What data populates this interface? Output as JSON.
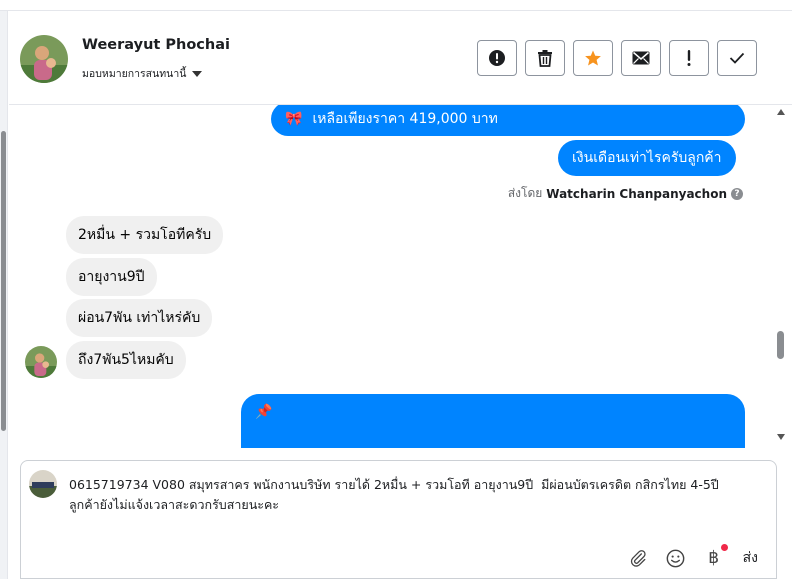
{
  "contact": {
    "name": "Weerayut Phochai",
    "assign_label": "มอบหมายการสนทนานี้"
  },
  "actions": [
    {
      "id": "spam",
      "icon": "alert-circle-icon"
    },
    {
      "id": "delete",
      "icon": "trash-icon"
    },
    {
      "id": "star",
      "icon": "star-icon",
      "color": "#f7931e"
    },
    {
      "id": "mark-unread",
      "icon": "envelope-icon"
    },
    {
      "id": "follow-up",
      "icon": "exclamation-icon"
    },
    {
      "id": "done",
      "icon": "check-icon"
    }
  ],
  "messages": {
    "out_price": {
      "emoji": "🎀",
      "text": "เหลือเพียงราคา 419,000 บาท"
    },
    "out_salary": "เงินเดือนเท่าไรครับลูกค้า",
    "sent_by_prefix": "ส่งโดย",
    "sent_by_name": "Watcharin Chanpanyachon",
    "in_1": "2หมื่น + รวมโอทีครับ",
    "in_2": "อายุงาน9ปี",
    "in_3": "ผ่อน7พัน เท่าไหร่คับ",
    "in_4": "ถึง7พัน5ไหมคับ",
    "out_pin_emoji": "📌"
  },
  "composer": {
    "draft": "0615719734 V080 สมุทรสาคร พนักงานบริษัท รายได้ 2หมื่น + รวมโอที อายุงาน9ปี  มีผ่อนบัตรเครดิต กสิกรไทย 4-5ปี\nลูกค้ายังไม่แจ้งเวลาสะดวกรับสายนะคะ",
    "baht_symbol": "฿",
    "send_label": "ส่ง"
  },
  "colors": {
    "bubble_out": "#0084ff",
    "bubble_in": "#f0f0f0",
    "star": "#f7931e",
    "notify_dot": "#f02849"
  }
}
